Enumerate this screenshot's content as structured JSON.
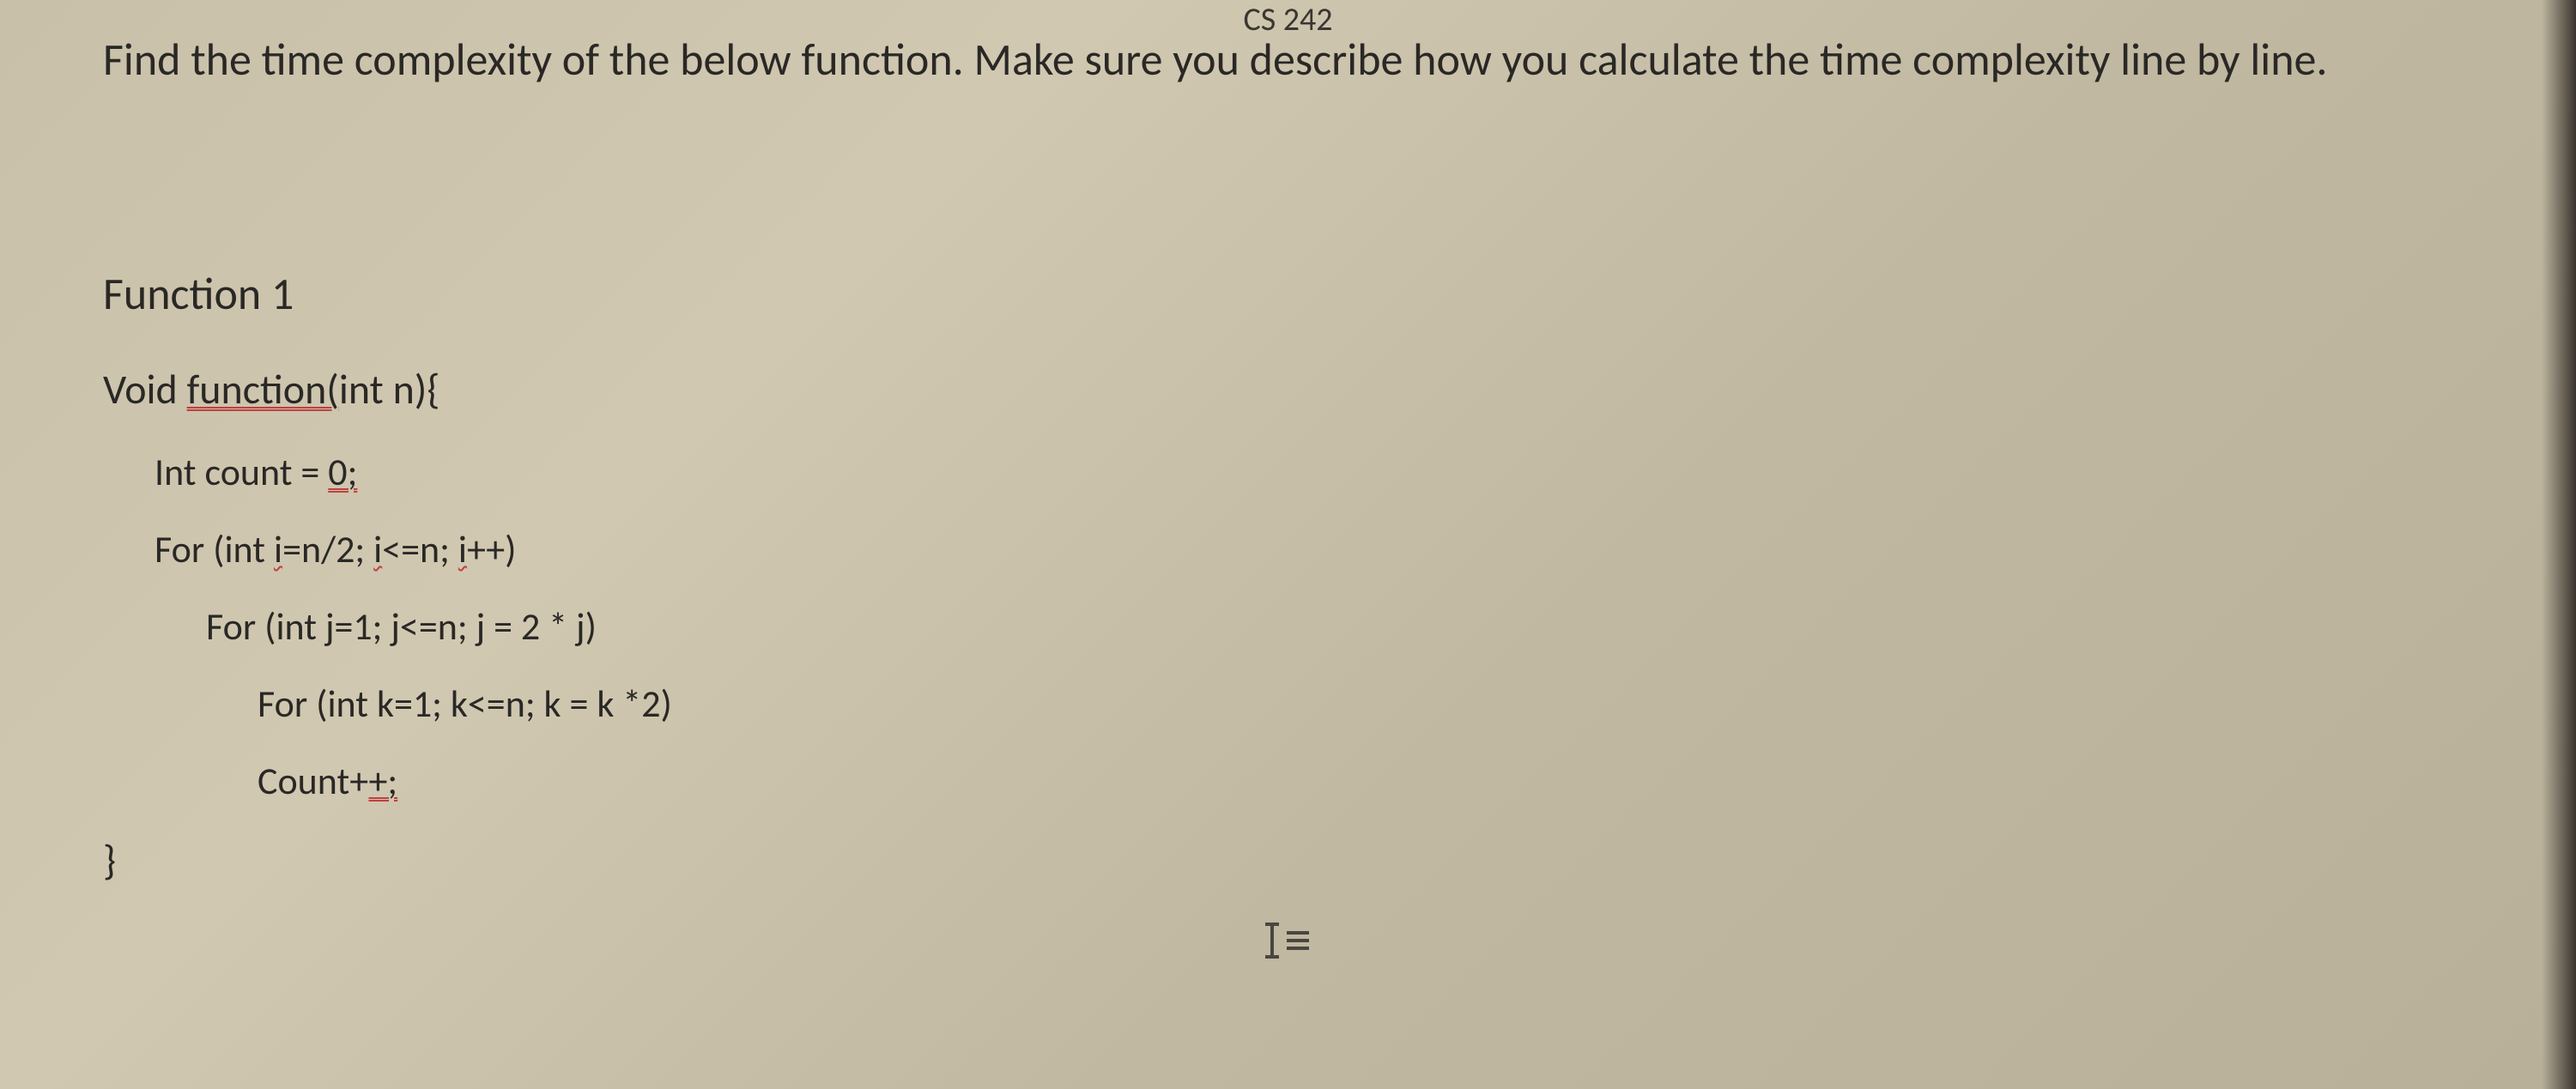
{
  "header": {
    "course": "CS 242"
  },
  "prompt": "Find the time complexity of the below function. Make sure you describe how you calculate the time complexity line by line.",
  "function": {
    "title": "Function 1",
    "decl_prefix": "Void ",
    "decl_name": "function(",
    "decl_suffix": "int n){",
    "lines": {
      "init_prefix": "Int count = ",
      "init_val": "0;",
      "for_i_a": "For (int ",
      "for_i_b": "i",
      "for_i_c": "=n/2; ",
      "for_i_d": "i",
      "for_i_e": "<=n; ",
      "for_i_f": "i",
      "for_i_g": "++)",
      "for_j": "For (int j=1; j<=n; j = 2 * j)",
      "for_k": "For (int k=1; k<=n; k = k *2)",
      "count_a": "Count+",
      "count_b": "+;",
      "close": "}"
    }
  }
}
